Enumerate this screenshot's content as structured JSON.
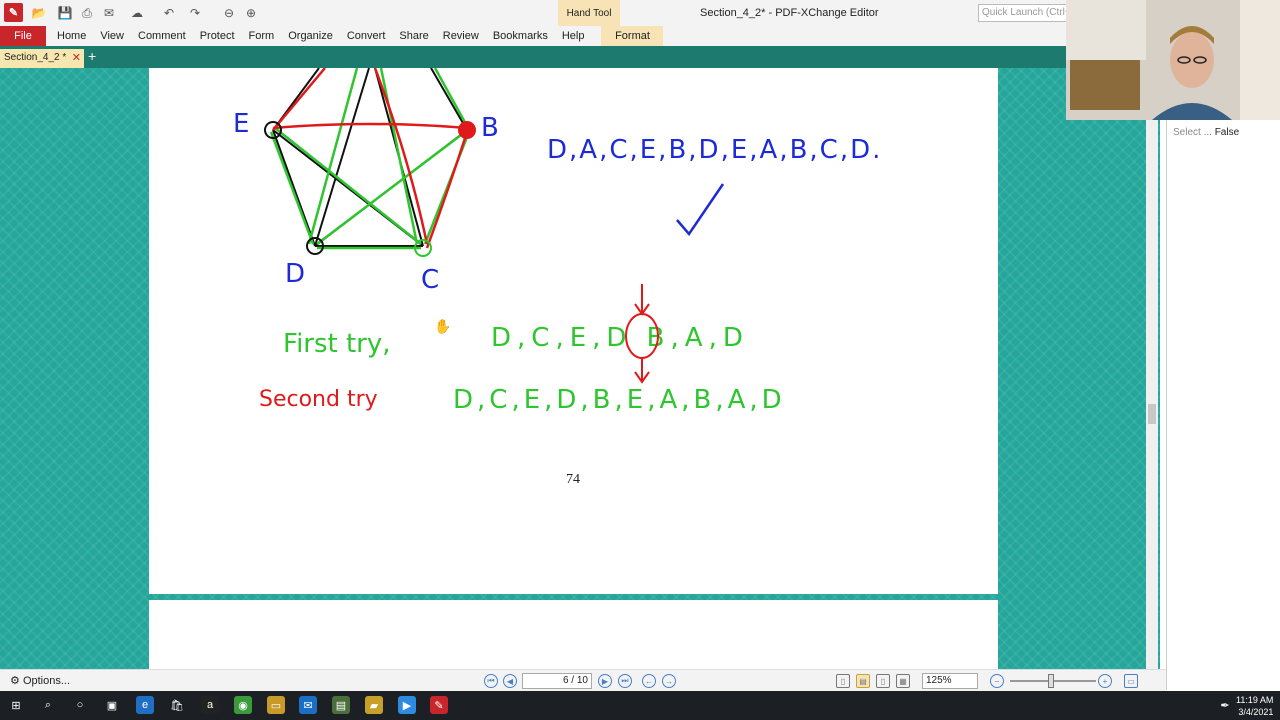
{
  "title_bar": {
    "window_title": "Section_4_2* - PDF-XChange Editor",
    "hand_tool_label": "Hand Tool",
    "quick_launch_placeholder": "Quick Launch (Ctrl+."
  },
  "menu": {
    "file": "File",
    "items": [
      "Home",
      "View",
      "Comment",
      "Protect",
      "Form",
      "Organize",
      "Convert",
      "Share",
      "Review",
      "Bookmarks",
      "Help"
    ],
    "format": "Format"
  },
  "tabs": {
    "doc_tab": "Section_4_2 *"
  },
  "page": {
    "number": "74"
  },
  "ink": {
    "vertex_e": "E",
    "vertex_b": "B",
    "vertex_d": "D",
    "vertex_c": "C",
    "sequence_blue": "D,A,C,E,B,D,E,A,B,C,D.",
    "first_try_label": "First try,",
    "first_try_sequence": "D,C,E,D B,A,D",
    "circled_vertex": "B",
    "second_try_label": "Second try",
    "second_try_sequence": "D,C,E,D,B,E,A,B,A,D",
    "colors": {
      "blue": "#1d2bd6",
      "green": "#2ec52e",
      "red": "#e01a1a",
      "black": "#111111"
    }
  },
  "right_panel": {
    "label": "Select ...",
    "value": "False"
  },
  "status_bar": {
    "options": "Options...",
    "page_field": "6 / 10",
    "zoom": "125%"
  },
  "taskbar": {
    "time": "11:19 AM",
    "date": "3/4/2021"
  }
}
